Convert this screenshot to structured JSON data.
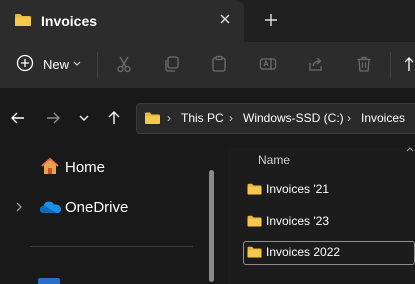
{
  "window": {
    "tab_title": "Invoices"
  },
  "toolbar": {
    "new_label": "New",
    "icons": [
      "cut-icon",
      "copy-icon",
      "paste-icon",
      "rename-icon",
      "share-icon",
      "delete-icon"
    ]
  },
  "address": {
    "crumbs": [
      "This PC",
      "Windows-SSD (C:)",
      "Invoices"
    ]
  },
  "nav": {
    "items": [
      {
        "label": "Home"
      },
      {
        "label": "OneDrive"
      }
    ]
  },
  "content": {
    "column_name": "Name",
    "folders": [
      {
        "label": "Invoices '21",
        "selected": false
      },
      {
        "label": "Invoices '23",
        "selected": false
      },
      {
        "label": "Invoices 2022",
        "selected": true
      }
    ]
  },
  "colors": {
    "folder": "#e8b93b",
    "accent": "#4cc2ff"
  }
}
